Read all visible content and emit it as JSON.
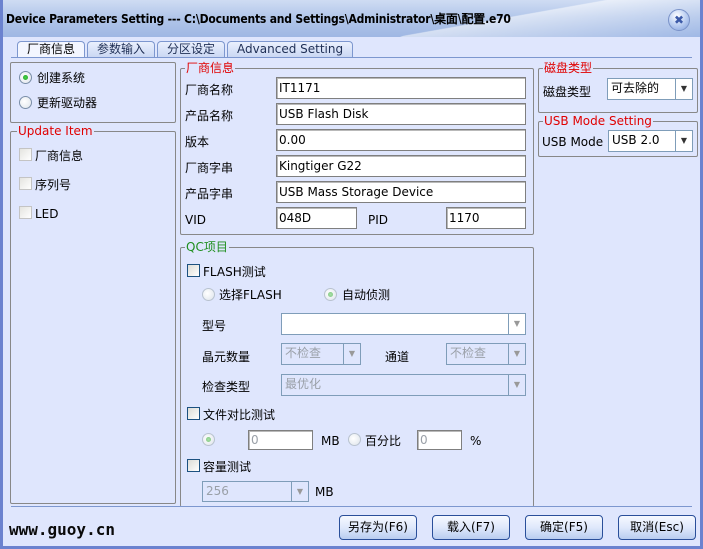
{
  "window": {
    "title": "Device Parameters Setting --- C:\\Documents and Settings\\Administrator\\桌面\\配置.e70",
    "close_icon": "close-icon"
  },
  "tabs": [
    {
      "label": "厂商信息",
      "active": true
    },
    {
      "label": "参数输入",
      "active": false
    },
    {
      "label": "分区设定",
      "active": false
    },
    {
      "label": "Advanced Setting",
      "active": false
    }
  ],
  "mode": {
    "options": [
      {
        "label": "创建系统",
        "selected": true
      },
      {
        "label": "更新驱动器",
        "selected": false
      }
    ]
  },
  "update_item": {
    "legend": "Update Item",
    "items": [
      {
        "label": "厂商信息",
        "checked": false
      },
      {
        "label": "序列号",
        "checked": false
      },
      {
        "label": "LED",
        "checked": false
      }
    ]
  },
  "vendor_info": {
    "legend": "厂商信息",
    "fields": [
      {
        "label": "厂商名称",
        "value": "IT1171"
      },
      {
        "label": "产品名称",
        "value": "USB Flash Disk"
      },
      {
        "label": "版本",
        "value": "0.00"
      },
      {
        "label": "厂商字串",
        "value": "Kingtiger G22"
      },
      {
        "label": "产品字串",
        "value": "USB Mass Storage Device"
      }
    ],
    "vid_label": "VID",
    "vid_value": "048D",
    "pid_label": "PID",
    "pid_value": "1170"
  },
  "disk_type": {
    "legend": "磁盘类型",
    "label": "磁盘类型",
    "value": "可去除的"
  },
  "usb_mode": {
    "legend": "USB Mode Setting",
    "label": "USB Mode :",
    "value": "USB 2.0"
  },
  "qc": {
    "legend": "QC项目",
    "flash_test": {
      "label": "FLASH测试",
      "checked": false
    },
    "select_flash": {
      "label": "选择FLASH",
      "selected": false
    },
    "auto_detect": {
      "label": "自动侦测",
      "selected": true
    },
    "model": {
      "label": "型号",
      "value": ""
    },
    "die_count": {
      "label": "晶元数量",
      "value": "不检查"
    },
    "channel": {
      "label": "通道",
      "value": "不检查"
    },
    "check_type": {
      "label": "检查类型",
      "value": "最优化"
    },
    "file_compare": {
      "label": "文件对比测试",
      "checked": false
    },
    "mb_option": {
      "selected": true,
      "value": "0",
      "unit": "MB"
    },
    "percent_option": {
      "label": "百分比",
      "selected": false,
      "value": "0",
      "unit": "%"
    },
    "capacity_test": {
      "label": "容量测试",
      "checked": false
    },
    "capacity": {
      "value": "256",
      "unit": "MB"
    }
  },
  "footer": {
    "watermark": "www.guoy.cn",
    "save_as": "另存为(F6)",
    "load": "载入(F7)",
    "ok": "确定(F5)",
    "cancel": "取消(Esc)"
  }
}
